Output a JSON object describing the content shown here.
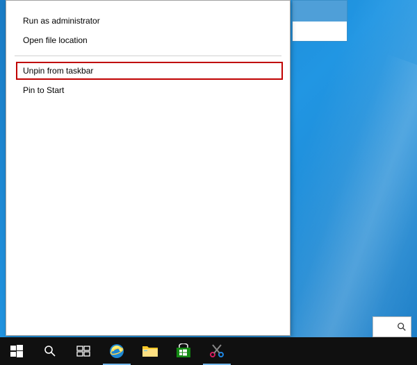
{
  "menu": {
    "run_admin": "Run as administrator",
    "open_location": "Open file location",
    "unpin_taskbar": "Unpin from taskbar",
    "pin_start": "Pin to Start"
  },
  "taskbar": {
    "start": "start-button",
    "search": "search-button",
    "taskview": "task-view-button",
    "ie": "internet-explorer",
    "explorer": "file-explorer",
    "store": "windows-store",
    "snip": "snipping-tool"
  }
}
